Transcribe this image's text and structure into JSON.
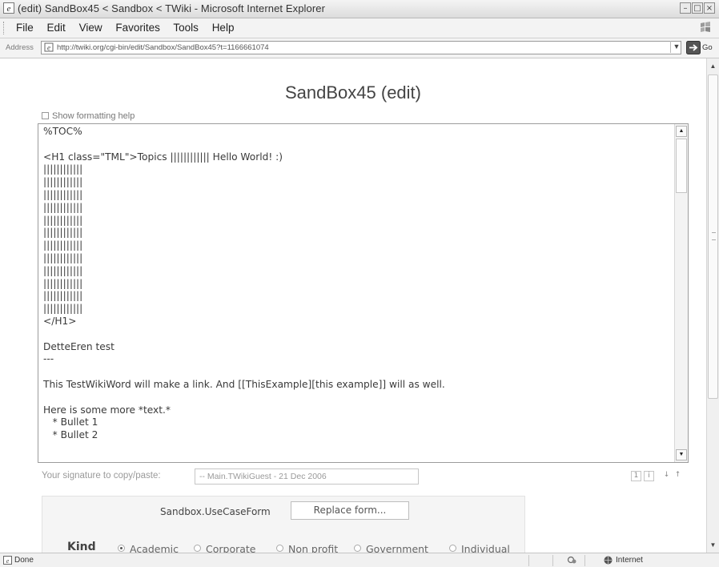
{
  "window": {
    "title": "(edit) SandBox45 < Sandbox < TWiki - Microsoft Internet Explorer",
    "controls": {
      "minimize": "–",
      "maximize": "□",
      "close": "×"
    }
  },
  "menu": {
    "items": [
      "File",
      "Edit",
      "View",
      "Favorites",
      "Tools",
      "Help"
    ]
  },
  "address": {
    "label": "Address",
    "url": "http://twiki.org/cgi-bin/edit/Sandbox/SandBox45?t=1166661074",
    "go": "Go"
  },
  "page": {
    "title": "SandBox45 (edit)",
    "help_toggle": "Show formatting help",
    "editor_text": "%TOC%\n\n<H1 class=\"TML\">Topics |||||||||||| Hello World! :)\n||||||||||||\n||||||||||||\n||||||||||||\n||||||||||||\n||||||||||||\n||||||||||||\n||||||||||||\n||||||||||||\n||||||||||||\n||||||||||||\n||||||||||||\n||||||||||||\n</H1>\n\nDetteEren test\n---\n\nThis TestWikiWord will make a link. And [[ThisExample][this example]] will as well.\n\nHere is some more *text.*\n   * Bullet 1\n   * Bullet 2",
    "signature_label": "Your signature to copy/paste:",
    "signature_value": "-- Main.TWikiGuest - 21 Dec 2006",
    "editor_tools": [
      "1",
      "i",
      "↓",
      "↑"
    ]
  },
  "form": {
    "name": "Sandbox.UseCaseForm",
    "replace_button": "Replace form...",
    "kind_label": "Kind",
    "kind_options": [
      {
        "label": "Academic",
        "selected": true
      },
      {
        "label": "Corporate",
        "selected": false
      },
      {
        "label": "Non profit",
        "selected": false
      },
      {
        "label": "Government",
        "selected": false
      },
      {
        "label": "Individual",
        "selected": false
      }
    ]
  },
  "status": {
    "text": "Done",
    "zone": "Internet"
  }
}
